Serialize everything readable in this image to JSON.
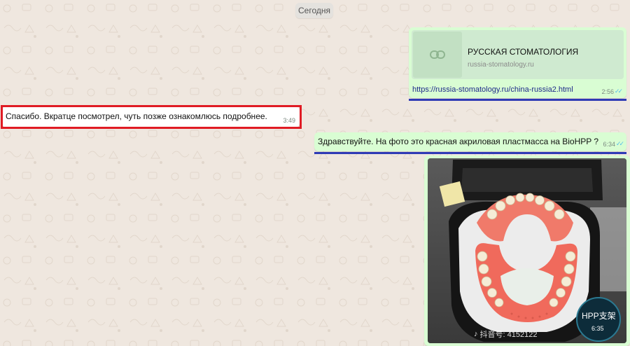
{
  "date_label": "Сегодня",
  "messages": [
    {
      "direction": "outgoing",
      "preview_title": "РУССКАЯ СТОМАТОЛОГИЯ",
      "preview_domain": "russia-stomatology.ru",
      "link_text": "https://russia-stomatology.ru/china-russia2.html",
      "time": "2:56",
      "read": true
    },
    {
      "direction": "incoming",
      "text": "Спасибо. Вкратце посмотрел, чуть позже ознакомлюсь подробнее.",
      "time": "3:49"
    },
    {
      "direction": "outgoing",
      "text": "Здравствуйте. На фото это красная акриловая пластмасса на BioHPP ?",
      "time": "6:34",
      "read": true
    },
    {
      "direction": "outgoing",
      "type": "photo",
      "watermark_text": "抖音号: 4152122",
      "badge_text": "HPP支架",
      "time": "6:35"
    }
  ],
  "colors": {
    "outgoing_bubble": "#d9fdd3",
    "incoming_bubble": "#ffffff",
    "highlight_red": "#e01b24",
    "highlight_blue": "#2f3bb5",
    "read_ticks": "#53bdeb"
  },
  "icons": {
    "link": "link-icon",
    "read_receipt": "double-check-icon",
    "tiktok": "tiktok-icon"
  }
}
